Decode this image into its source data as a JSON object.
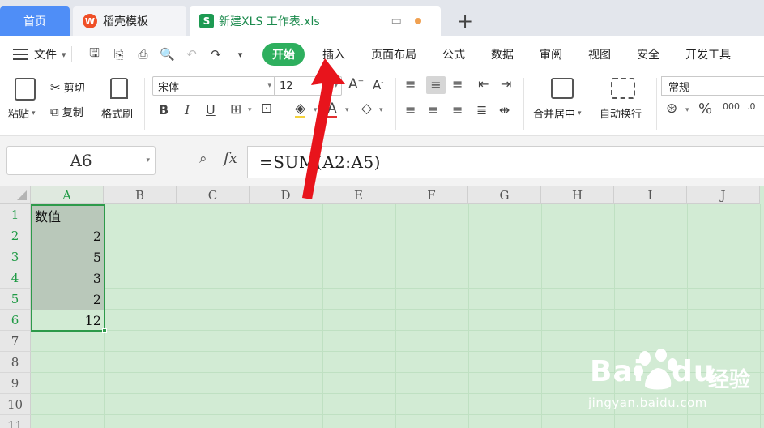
{
  "tabs": {
    "home": "首页",
    "template": "稻壳模板",
    "file": "新建XLS 工作表.xls"
  },
  "menu": {
    "file": "文件",
    "tabs": [
      "开始",
      "插入",
      "页面布局",
      "公式",
      "数据",
      "审阅",
      "视图",
      "安全",
      "开发工具"
    ]
  },
  "ribbon": {
    "paste": "粘贴",
    "cut": "剪切",
    "copy": "复制",
    "format_painter": "格式刷",
    "font_name": "宋体",
    "font_size": "12",
    "merge_center": "合并居中",
    "wrap_text": "自动换行",
    "number_format": "常规"
  },
  "formula_bar": {
    "name_box": "A6",
    "fx": "fx",
    "formula": "=SUM(A2:A5)"
  },
  "sheet": {
    "columns": [
      "A",
      "B",
      "C",
      "D",
      "E",
      "F",
      "G",
      "H",
      "I",
      "J"
    ],
    "rows": [
      "1",
      "2",
      "3",
      "4",
      "5",
      "6",
      "7",
      "8",
      "9",
      "10",
      "11"
    ],
    "cells": {
      "A1": "数值",
      "A2": "2",
      "A3": "5",
      "A4": "3",
      "A5": "2",
      "A6": "12"
    }
  },
  "watermark": {
    "brand": "Bai",
    "brand2": "du",
    "cn": "经验",
    "url": "jingyan.baidu.com"
  },
  "colors": {
    "accent_green": "#2eaf5e",
    "sheet_bg": "#d2ebd4",
    "home_tab": "#4f8ef7",
    "arrow": "#e8141c"
  }
}
